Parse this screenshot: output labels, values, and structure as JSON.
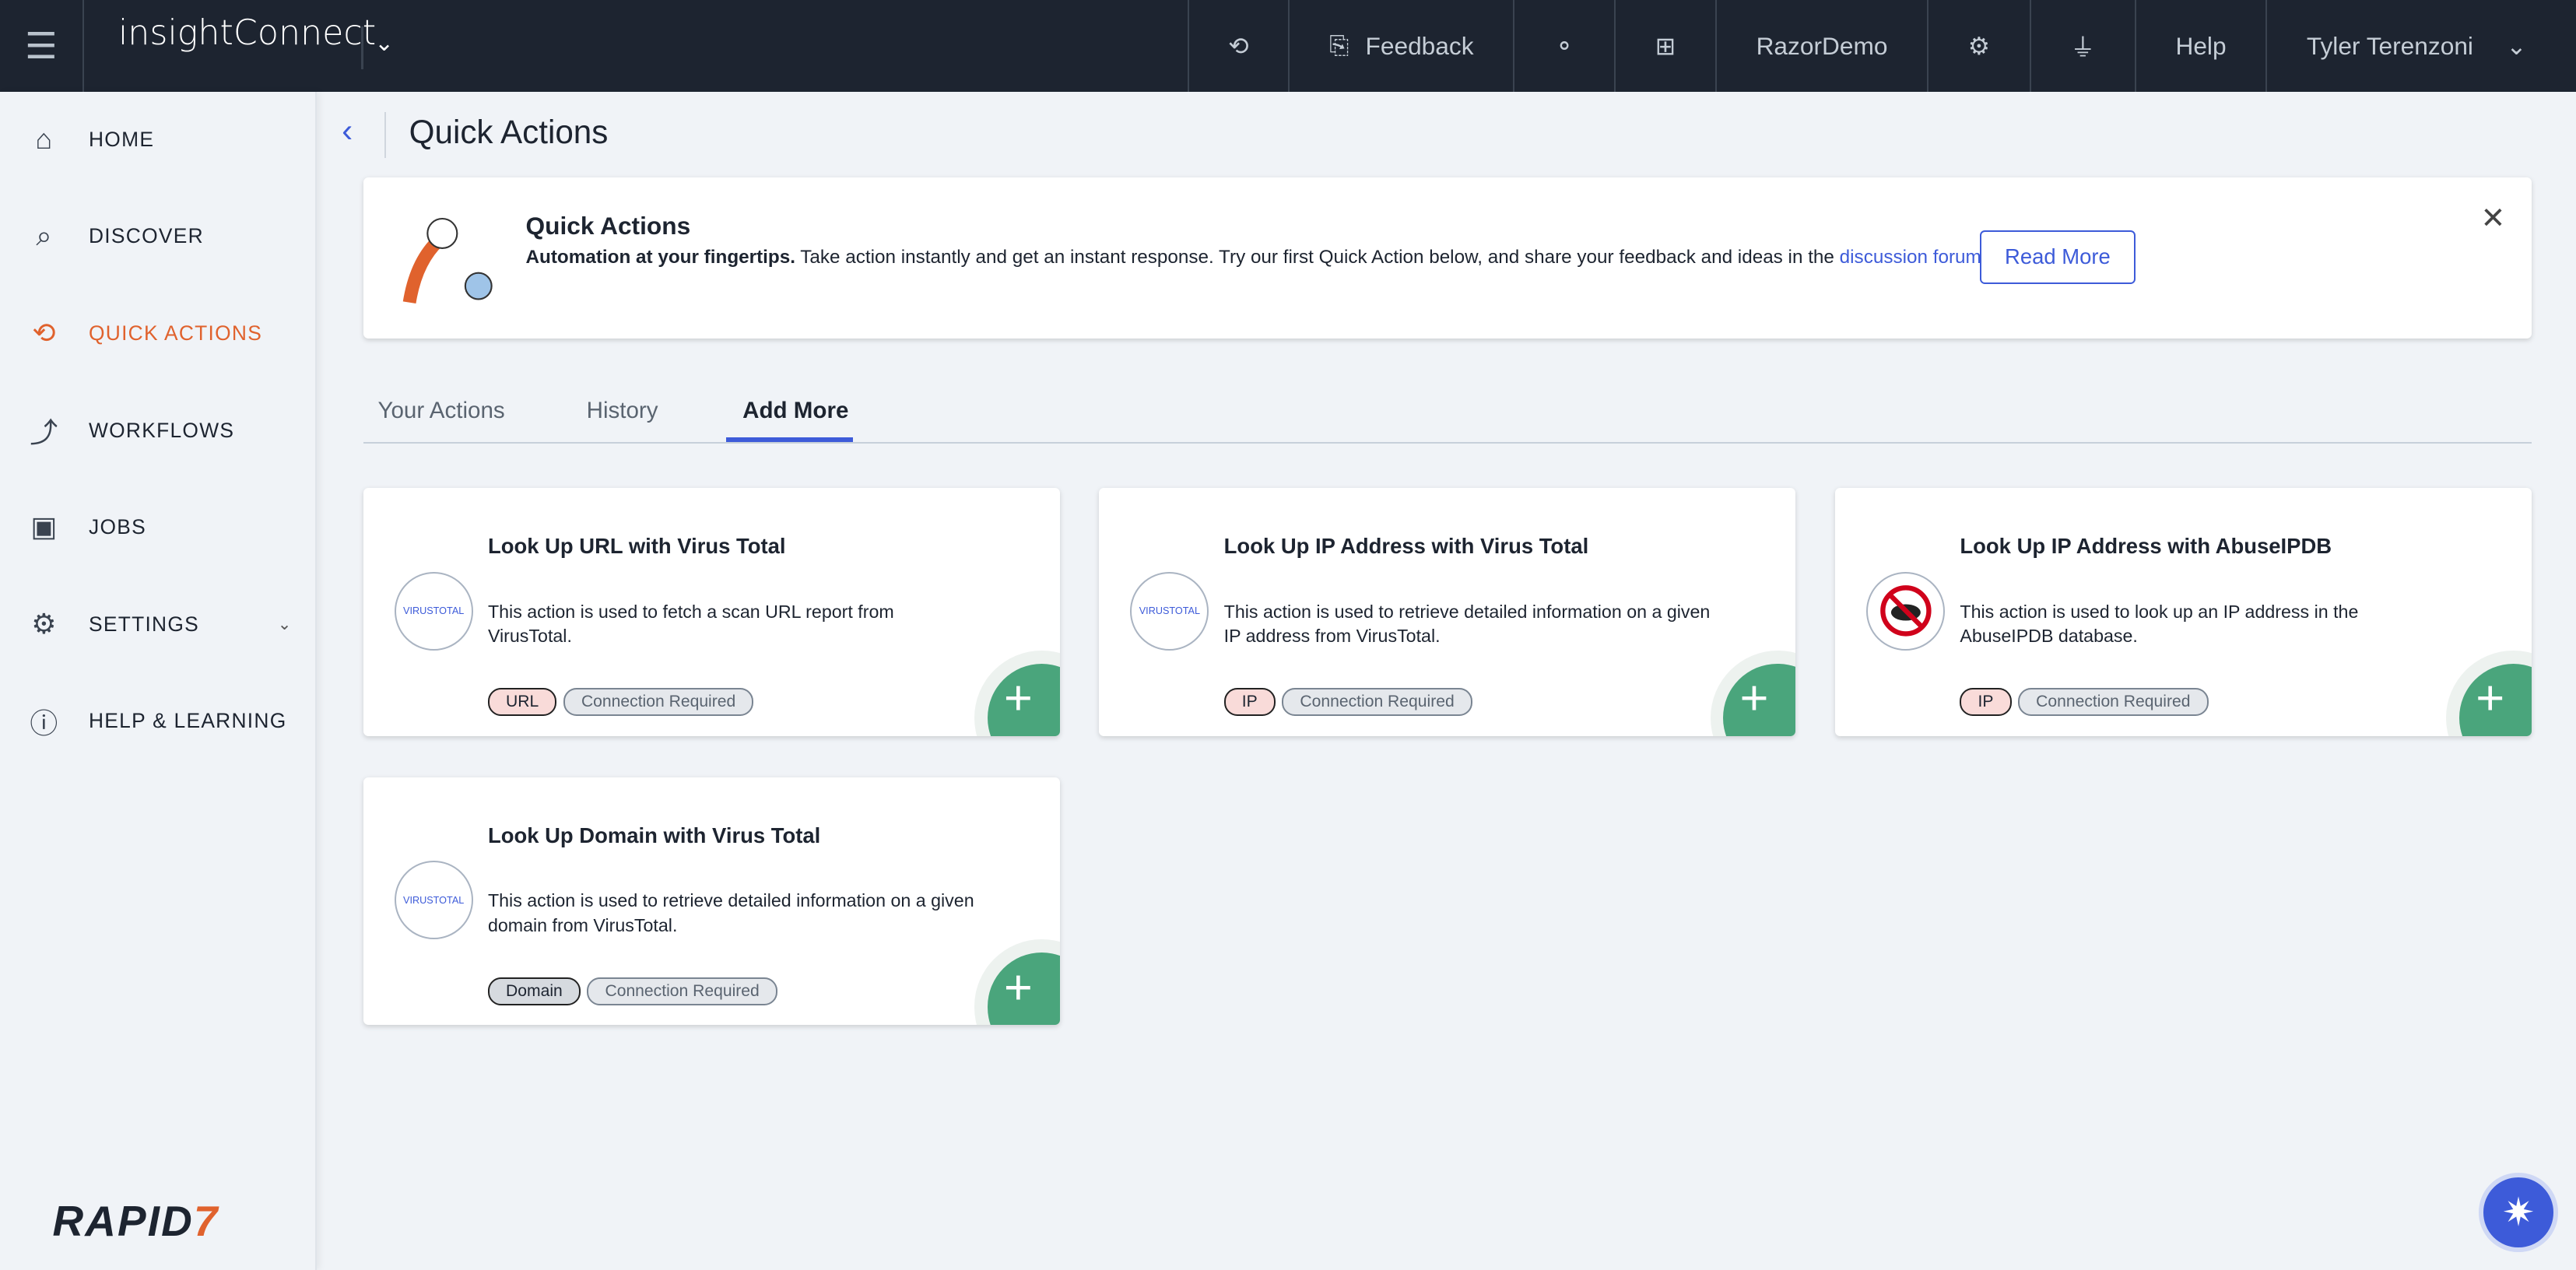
{
  "header": {
    "app_name": "insightConnect",
    "nav": {
      "feedback": "Feedback",
      "org": "RazorDemo",
      "help": "Help",
      "user": "Tyler Terenzoni"
    }
  },
  "sidebar": {
    "items": [
      {
        "label": "HOME"
      },
      {
        "label": "DISCOVER"
      },
      {
        "label": "QUICK ACTIONS"
      },
      {
        "label": "WORKFLOWS"
      },
      {
        "label": "JOBS"
      },
      {
        "label": "SETTINGS"
      },
      {
        "label": "HELP & LEARNING"
      }
    ],
    "brand": "RAPID",
    "brand_suffix": "7"
  },
  "page": {
    "title": "Quick Actions"
  },
  "banner": {
    "title": "Quick Actions",
    "bold": "Automation at your fingertips.",
    "text": " Take action instantly and get an instant response. Try our first Quick Action below, and share your feedback and ideas in the ",
    "link": "discussion forum",
    "end": ".",
    "button": "Read More"
  },
  "tabs": [
    {
      "label": "Your Actions"
    },
    {
      "label": "History"
    },
    {
      "label": "Add More"
    }
  ],
  "cards": [
    {
      "title": "Look Up URL with Virus Total",
      "desc": "This action is used to fetch a scan URL report from VirusTotal.",
      "tag": "URL",
      "conn": "Connection Required",
      "logo": "VIRUSTOTAL"
    },
    {
      "title": "Look Up IP Address with Virus Total",
      "desc": "This action is used to retrieve detailed information on a given IP address from VirusTotal.",
      "tag": "IP",
      "conn": "Connection Required",
      "logo": "VIRUSTOTAL"
    },
    {
      "title": "Look Up IP Address with AbuseIPDB",
      "desc": "This action is used to look up an IP address in the AbuseIPDB database.",
      "tag": "IP",
      "conn": "Connection Required"
    },
    {
      "title": "Look Up Domain with Virus Total",
      "desc": "This action is used to retrieve detailed information on a given domain from VirusTotal.",
      "tag": "Domain",
      "conn": "Connection Required",
      "logo": "VIRUSTOTAL"
    }
  ]
}
